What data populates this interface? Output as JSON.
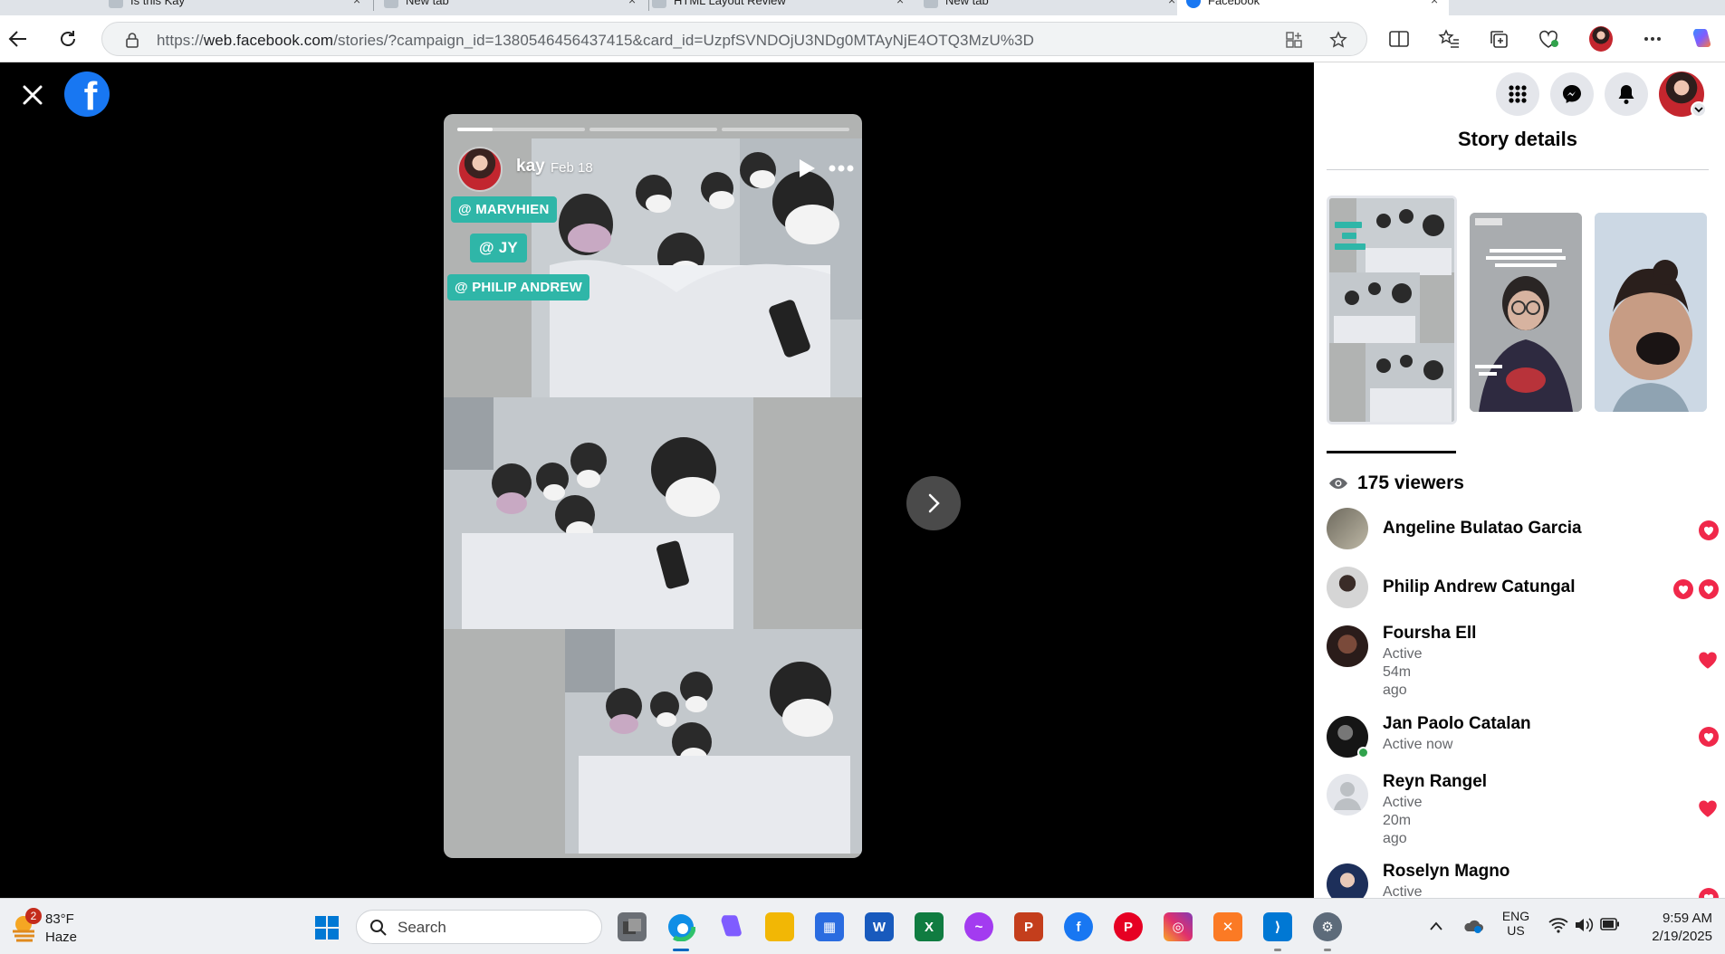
{
  "browser": {
    "tabs": [
      {
        "title": "Is this Kay"
      },
      {
        "title": "New tab"
      },
      {
        "title": "HTML Layout Review"
      },
      {
        "title": "New tab"
      },
      {
        "title": "Facebook"
      }
    ],
    "url_domain": "web.facebook.com",
    "url_prefix": "https://",
    "url_path": "/stories/?campaign_id=1380546456437415&card_id=UzpfSVNDOjU3NDg0MTAyNjE4OTQ3MzU%3D"
  },
  "story": {
    "user": "kay",
    "date": "Feb 18",
    "progress": [
      1.0,
      0.0,
      0.0
    ],
    "progress_current": 0.28,
    "tags": [
      "@ MARVHIEN",
      "@ JY",
      "@ PHILIP ANDREW"
    ]
  },
  "panel": {
    "title": "Story details",
    "viewer_count_label": "175 viewers",
    "viewers": [
      {
        "name": "Angeline Bulatao Garcia",
        "sub": "",
        "reactions": 1,
        "online": false
      },
      {
        "name": "Philip Andrew Catungal",
        "sub": "",
        "reactions": 2,
        "online": false
      },
      {
        "name": "Foursha Ell",
        "sub": "Active\n54m\nago",
        "reactions": 1,
        "online": false
      },
      {
        "name": "Jan Paolo Catalan",
        "sub": "Active now",
        "reactions": 1,
        "online": true
      },
      {
        "name": "Reyn Rangel",
        "sub": "Active\n20m\nago",
        "reactions": 1,
        "online": false
      },
      {
        "name": "Roselyn Magno",
        "sub": "Active",
        "reactions": 1,
        "online": false
      }
    ],
    "thumb_text": "angit yung gani mo sayo kapag yung gusto mo may gusto sayo HAHAHAHA",
    "thumb_caption": "honey po di nadya"
  },
  "taskbar": {
    "weather_badge": "2",
    "weather_temp": "83°F",
    "weather_cond": "Haze",
    "search_placeholder": "Search",
    "lang_top": "ENG",
    "lang_bottom": "US",
    "time": "9:59 AM",
    "date": "2/19/2025"
  },
  "colors": {
    "facebook_blue": "#1877f2",
    "reaction_red": "#f0284a",
    "tag_teal": "#2fb6a8",
    "online_green": "#31a24c"
  }
}
